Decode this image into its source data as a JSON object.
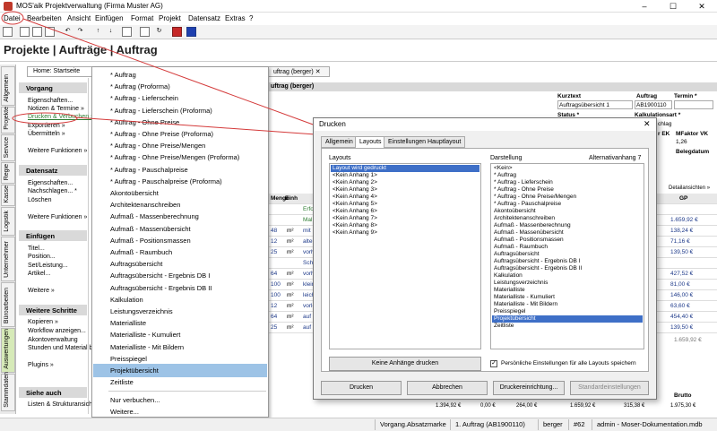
{
  "window": {
    "title": "MOS'aik Projektverwaltung (Firma Muster AG)",
    "minimize": "–",
    "maximize": "☐",
    "close": "✕"
  },
  "menubar": [
    "Datei",
    "Bearbeiten",
    "Ansicht",
    "Einfügen",
    "Format",
    "Projekt",
    "Datensatz",
    "Extras",
    "?"
  ],
  "page_title": "Projekte | Aufträge | Auftrag",
  "vtabs": [
    "Allgemein",
    "Projekte",
    "Service",
    "Regie",
    "Kasse",
    "Logistik",
    "Unternehmer",
    "Büroarbeiten",
    "Auswertungen",
    "Stammdaten"
  ],
  "doc_tabs": {
    "home": "Home: Startseite",
    "auftrag": "uftrag (berger)",
    "close": "✕"
  },
  "left_panel": {
    "vorgang": {
      "title": "Vorgang",
      "items": [
        "Eigenschaften...",
        "Notizen & Termine »",
        "Drucken & Verbuchen »",
        "Exportieren »",
        "Übermitteln »",
        "Weitere Funktionen »"
      ]
    },
    "datensatz": {
      "title": "Datensatz",
      "items": [
        "Eigenschaften...",
        "Nachschlagen... *",
        "Löschen",
        "Weitere Funktionen »"
      ]
    },
    "einfuegen": {
      "title": "Einfügen",
      "items": [
        "Titel...",
        "Position...",
        "Set/Leistung...",
        "Artikel...",
        "Weitere »"
      ]
    },
    "weitere": {
      "title": "Weitere Schritte",
      "items": [
        "Kopieren »",
        "Workflow anzeigen...",
        "Akontoverwaltung",
        "Stunden und Material b",
        "Plugins »"
      ]
    },
    "siehe": {
      "title": "Siehe auch",
      "items": [
        "Listen & Strukturansich"
      ]
    }
  },
  "dropdown": [
    "* Auftrag",
    "* Auftrag (Proforma)",
    "* Auftrag - Lieferschein",
    "* Auftrag - Lieferschein (Proforma)",
    "* Auftrag - Ohne Preise",
    "* Auftrag - Ohne Preise (Proforma)",
    "* Auftrag - Ohne Preise/Mengen",
    "* Auftrag - Ohne Preise/Mengen (Proforma)",
    "* Auftrag - Pauschalpreise",
    "* Auftrag - Pauschalpreise (Proforma)",
    "Akontoübersicht",
    "Architektenanschreiben",
    "Aufmaß - Massenberechnung",
    "Aufmaß - Massenübersicht",
    "Aufmaß - Positionsmassen",
    "Aufmaß - Raumbuch",
    "Auftragsübersicht",
    "Auftragsübersicht - Ergebnis DB I",
    "Auftragsübersicht - Ergebnis DB II",
    "Kalkulation",
    "Leistungsverzeichnis",
    "Materialliste",
    "Materialliste - Kumuliert",
    "Materialliste - Mit Bildern",
    "Preisspiegel",
    "Projektübersicht",
    "Zeitliste",
    "Nur verbuchen...",
    "Weitere..."
  ],
  "background": {
    "header_strip": "uftrag (berger)",
    "kurztext_label": "Kurztext",
    "kurztext_value": "Auftragsübersicht 1",
    "auftrag_label": "Auftrag",
    "auftrag_value": "AB1900110",
    "termin_label": "Termin *",
    "status_label": "Status *",
    "kalk_label": "Kalkulationsart *",
    "kalk_value": "chlag",
    "ek_label": "r EK",
    "mfaktor_label": "MFaktor VK",
    "mfaktor_value": "1,26",
    "belegdatum_label": "Belegdatum",
    "detail_link": "Detailansichten »",
    "col_menge": "Menge",
    "col_einh": "Einh",
    "col_gp": "GP",
    "rows": [
      {
        "menge": "",
        "einh": "",
        "text": "Erfo",
        "gp": ""
      },
      {
        "menge": "",
        "einh": "",
        "text": "Mal",
        "gp": "1.659,92 €"
      },
      {
        "menge": "48",
        "einh": "m²",
        "text": "mit P",
        "gp": "138,24 €"
      },
      {
        "menge": "12",
        "einh": "m²",
        "text": "alter",
        "gp": "71,16 €"
      },
      {
        "menge": "25",
        "einh": "m²",
        "text": "vorh",
        "gp": "139,50 €"
      },
      {
        "menge": "",
        "einh": "",
        "text": "Schu",
        "gp": ""
      },
      {
        "menge": "64",
        "einh": "m²",
        "text": "vorh",
        "gp": "427,52 €"
      },
      {
        "menge": "100",
        "einh": "m²",
        "text": "klein",
        "gp": "81,00 €"
      },
      {
        "menge": "100",
        "einh": "m²",
        "text": "leich",
        "gp": "146,00 €"
      },
      {
        "menge": "12",
        "einh": "m²",
        "text": "vorle",
        "gp": "63,60 €"
      },
      {
        "menge": "64",
        "einh": "m²",
        "text": "auf d",
        "gp": "454,40 €"
      },
      {
        "menge": "25",
        "einh": "m²",
        "text": "auf d",
        "gp": "139,50 €"
      }
    ],
    "total_gp": "1.659,92 €",
    "footer_row": [
      "1.394,92 €",
      "0,00 €",
      "264,00 €",
      "1.659,92 €",
      "315,38 €",
      "1.975,30 €"
    ],
    "brutto_label": "Brutto"
  },
  "dialog": {
    "title": "Drucken",
    "close": "✕",
    "tabs": [
      "Allgemein",
      "Layouts",
      "Einstellungen Hauptlayout"
    ],
    "layouts_label": "Layouts",
    "layouts": [
      "Layout wird gedruckt",
      "<Kein Anhang 1>",
      "<Kein Anhang 2>",
      "<Kein Anhang 3>",
      "<Kein Anhang 4>",
      "<Kein Anhang 5>",
      "<Kein Anhang 6>",
      "<Kein Anhang 7>",
      "<Kein Anhang 8>",
      "<Kein Anhang 9>"
    ],
    "darstellung_label": "Darstellung",
    "alternativ_label": "Alternativanhang 7",
    "darstellung": [
      "<Kein>",
      "* Auftrag",
      "* Auftrag - Lieferschein",
      "* Auftrag - Ohne Preise",
      "* Auftrag - Ohne Preise/Mengen",
      "* Auftrag - Pauschalpreise",
      "Akontoübersicht",
      "Architektenanschreiben",
      "Aufmaß - Massenberechnung",
      "Aufmaß - Massenübersicht",
      "Aufmaß - Positionsmassen",
      "Aufmaß - Raumbuch",
      "Auftragsübersicht",
      "Auftragsübersicht - Ergebnis DB I",
      "Auftragsübersicht - Ergebnis DB II",
      "Kalkulation",
      "Leistungsverzeichnis",
      "Materialliste",
      "Materialliste - Kumuliert",
      "Materialliste - Mit Bildern",
      "Preisspiegel",
      "Projektübersicht",
      "Zeitliste"
    ],
    "keine_anhaenge": "Keine Anhänge drucken",
    "persoenlich": "Persönliche Einstellungen für alle Layouts speichern",
    "check_mark": "✓",
    "buttons": [
      "Drucken",
      "Abbrechen",
      "Druckereinrichtung...",
      "Standardeinstellungen"
    ]
  },
  "statusbar": [
    "Vorgang.Absatzmarke",
    "1. Auftrag (AB1900110)",
    "berger",
    "#62",
    "admin - Moser-Dokumentation.mdb"
  ]
}
